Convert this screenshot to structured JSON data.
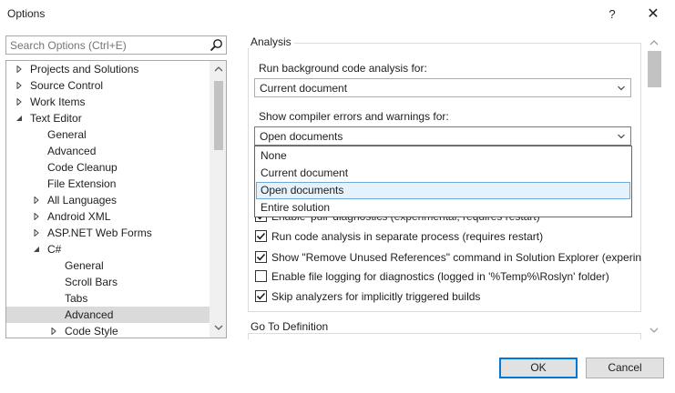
{
  "window": {
    "title": "Options",
    "help_label": "?",
    "close_label": "✕"
  },
  "search": {
    "placeholder": "Search Options (Ctrl+E)"
  },
  "tree": [
    {
      "label": "Projects and Solutions",
      "level": 0,
      "arrow": "right"
    },
    {
      "label": "Source Control",
      "level": 0,
      "arrow": "right"
    },
    {
      "label": "Work Items",
      "level": 0,
      "arrow": "right"
    },
    {
      "label": "Text Editor",
      "level": 0,
      "arrow": "down"
    },
    {
      "label": "General",
      "level": 1,
      "arrow": ""
    },
    {
      "label": "Advanced",
      "level": 1,
      "arrow": ""
    },
    {
      "label": "Code Cleanup",
      "level": 1,
      "arrow": ""
    },
    {
      "label": "File Extension",
      "level": 1,
      "arrow": ""
    },
    {
      "label": "All Languages",
      "level": 1,
      "arrow": "right"
    },
    {
      "label": "Android XML",
      "level": 1,
      "arrow": "right"
    },
    {
      "label": "ASP.NET Web Forms",
      "level": 1,
      "arrow": "right"
    },
    {
      "label": "C#",
      "level": 1,
      "arrow": "down"
    },
    {
      "label": "General",
      "level": 2,
      "arrow": ""
    },
    {
      "label": "Scroll Bars",
      "level": 2,
      "arrow": ""
    },
    {
      "label": "Tabs",
      "level": 2,
      "arrow": ""
    },
    {
      "label": "Advanced",
      "level": 2,
      "arrow": "",
      "selected": true
    },
    {
      "label": "Code Style",
      "level": 2,
      "arrow": "right"
    }
  ],
  "analysis": {
    "group_title": "Analysis",
    "background_label": "Run background code analysis for:",
    "background_value": "Current document",
    "errors_label": "Show compiler errors and warnings for:",
    "errors_value": "Open documents",
    "dropdown_options": [
      "None",
      "Current document",
      "Open documents",
      "Entire solution"
    ],
    "dropdown_hover_index": 2,
    "checks": [
      {
        "label": "Enable 'pull' diagnostics (experimental, requires restart)",
        "checked": true
      },
      {
        "label": "Run code analysis in separate process (requires restart)",
        "checked": true
      },
      {
        "label": "Show \"Remove Unused References\" command in Solution Explorer (experin",
        "checked": true
      },
      {
        "label": "Enable file logging for diagnostics (logged in '%Temp%\\Roslyn' folder)",
        "checked": false
      },
      {
        "label": "Skip analyzers for implicitly triggered builds",
        "checked": true
      }
    ]
  },
  "goto": {
    "group_title": "Go To Definition"
  },
  "buttons": {
    "ok": "OK",
    "cancel": "Cancel"
  },
  "colors": {
    "accent": "#0078d7",
    "selection": "#dadada",
    "hover": "#e5f1fb"
  }
}
